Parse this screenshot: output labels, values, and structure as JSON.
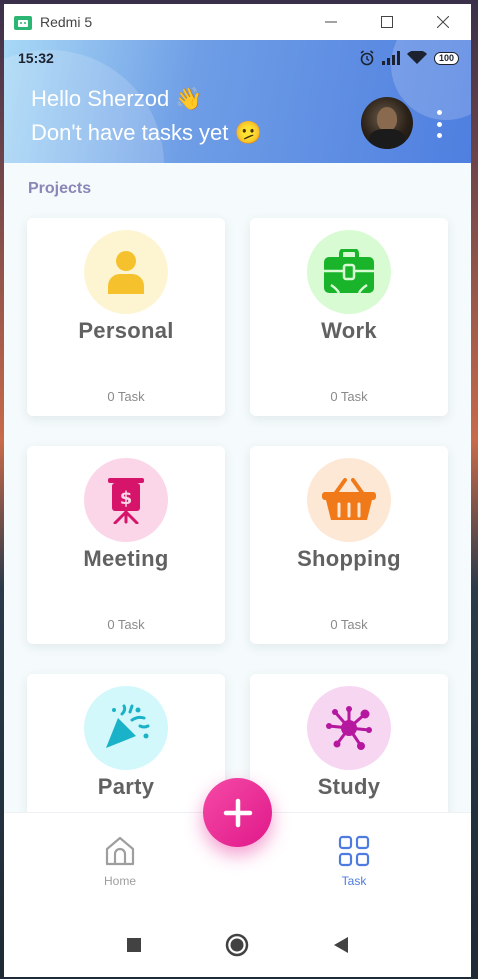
{
  "window": {
    "title": "Redmi 5"
  },
  "status": {
    "time": "15:32",
    "battery": "100"
  },
  "header": {
    "greeting_line1": "Hello Sherzod 👋",
    "greeting_line2": "Don't have tasks yet 🫤"
  },
  "projects_title": "Projects",
  "projects": [
    {
      "name": "Personal",
      "count": "0 Task",
      "icon": "person-icon",
      "color": "#f5c22e",
      "bg": "#fdf5d2"
    },
    {
      "name": "Work",
      "count": "0 Task",
      "icon": "briefcase-icon",
      "color": "#19b42a",
      "bg": "#d8fbd3"
    },
    {
      "name": "Meeting",
      "count": "0 Task",
      "icon": "presentation-board-icon",
      "color": "#d6146a",
      "bg": "#fbd6e8"
    },
    {
      "name": "Shopping",
      "count": "0 Task",
      "icon": "shopping-basket-icon",
      "color": "#f07a1a",
      "bg": "#fde8d6"
    },
    {
      "name": "Party",
      "count": "",
      "icon": "party-popper-icon",
      "color": "#1ab2c8",
      "bg": "#d2f8fb"
    },
    {
      "name": "Study",
      "count": "",
      "icon": "molecule-icon",
      "color": "#b5179e",
      "bg": "#f7d6f2"
    }
  ],
  "nav": {
    "home_label": "Home",
    "task_label": "Task"
  },
  "colors": {
    "accent": "#4e7be0",
    "fab": "#e91e8c"
  }
}
